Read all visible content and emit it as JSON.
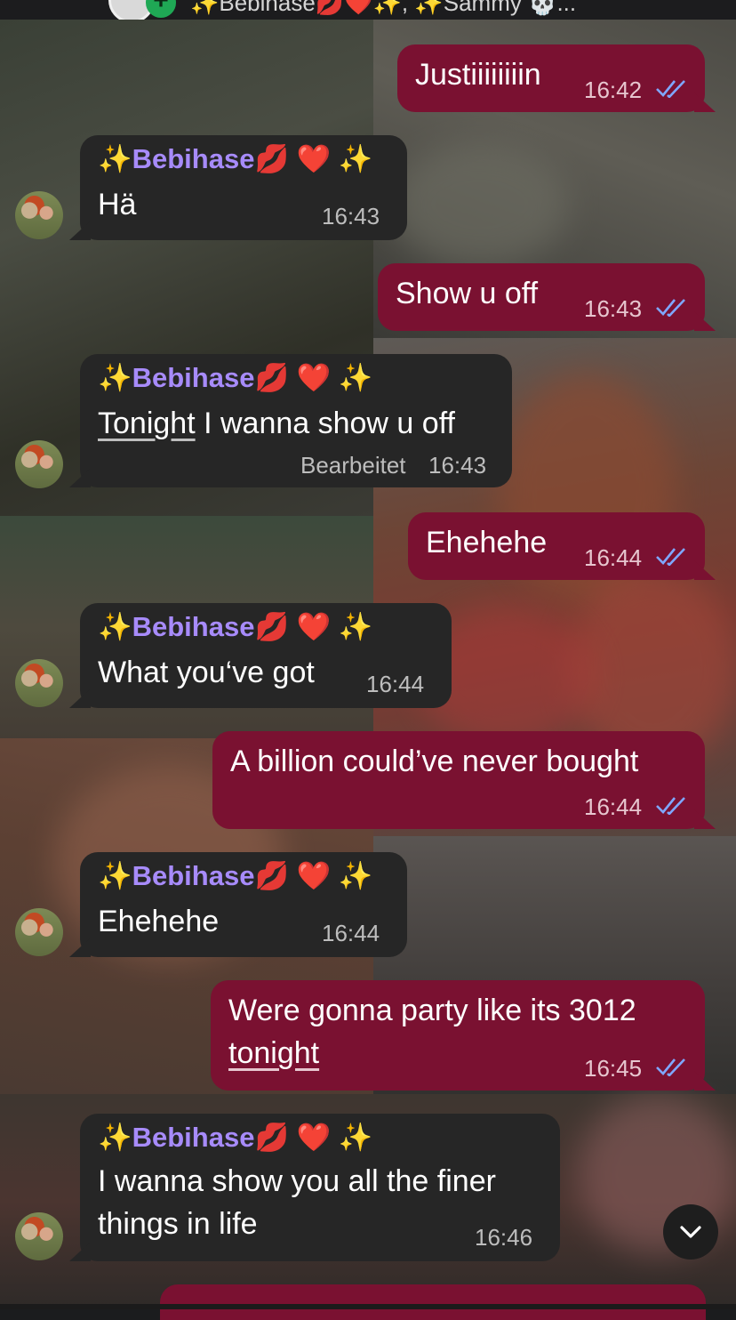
{
  "header": {
    "title": "✨Bebihase💋❤️✨, ✨Sammy 💀...",
    "plus_icon": "+"
  },
  "colors": {
    "outgoing_bubble": "#7a1131",
    "incoming_bubble": "#262626",
    "sender_name": "#a78bfa",
    "read_ticks": "#7fa7ff"
  },
  "sender": {
    "name": "Bebihase",
    "prefix_emoji": "✨",
    "suffix_emoji": "💋",
    "heart": "❤️"
  },
  "messages": [
    {
      "direction": "out",
      "text": "Justiiiiiiiin",
      "time": "16:42",
      "status": "read"
    },
    {
      "direction": "in",
      "text": "Hä",
      "time": "16:43"
    },
    {
      "direction": "out",
      "text": "Show u off",
      "time": "16:43",
      "status": "read"
    },
    {
      "direction": "in",
      "text_underlined": "Tonight",
      "text": " I wanna show u off",
      "edited_label": "Bearbeitet",
      "time": "16:43"
    },
    {
      "direction": "out",
      "text": "Ehehehe",
      "time": "16:44",
      "status": "read"
    },
    {
      "direction": "in",
      "text": "What you‘ve got",
      "time": "16:44"
    },
    {
      "direction": "out",
      "text": "A billion could’ve never bought",
      "time": "16:44",
      "status": "read"
    },
    {
      "direction": "in",
      "text": "Ehehehe",
      "time": "16:44"
    },
    {
      "direction": "out",
      "line1": "Were gonna party like its 3012",
      "line2": "tonight",
      "time": "16:45",
      "status": "read"
    },
    {
      "direction": "in",
      "line1": "I wanna show you all the finer",
      "line2": "things in life",
      "time": "16:46"
    }
  ],
  "scroll_button_icon": "chevron-down-icon"
}
